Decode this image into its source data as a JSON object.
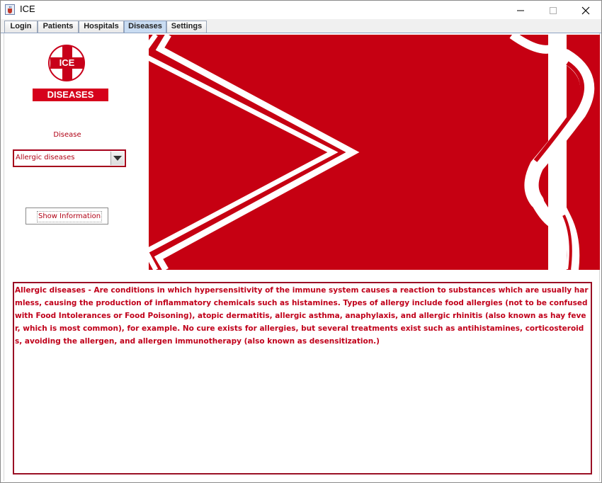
{
  "window": {
    "title": "ICE"
  },
  "tabs": [
    {
      "label": "Login",
      "active": false
    },
    {
      "label": "Patients",
      "active": false
    },
    {
      "label": "Hospitals",
      "active": false
    },
    {
      "label": "Diseases",
      "active": true
    },
    {
      "label": "Settings",
      "active": false
    }
  ],
  "logo": {
    "emblem_text": "ICE",
    "banner_text": "DISEASES"
  },
  "form": {
    "disease_label": "Disease",
    "disease_selected": "Allergic diseases",
    "show_button_label": "Show Information"
  },
  "info": {
    "text": "Allergic diseases - Are conditions in which hypersensitivity of the immune system causes a reaction to substances which are usually harmless, causing the production of inflammatory chemicals such as histamines. Types of allergy include food allergies (not to be confused with Food Intolerances or Food Poisoning), atopic dermatitis, allergic asthma, anaphylaxis, and allergic rhinitis (also known as hay fever, which is most common), for example. No cure exists for allergies, but several treatments exist such as antihistamines, corticosteroids, avoiding the allergen, and allergen immunotherapy (also known as desensitization.)"
  },
  "icons": {
    "app": "java-cup-icon",
    "minimize": "minimize-icon",
    "maximize": "maximize-icon",
    "close": "close-icon",
    "dropdown": "chevron-down-icon"
  },
  "colors": {
    "accent_red": "#c8001a",
    "text_red": "#c0001a",
    "tab_active": "#c9dcf2"
  }
}
